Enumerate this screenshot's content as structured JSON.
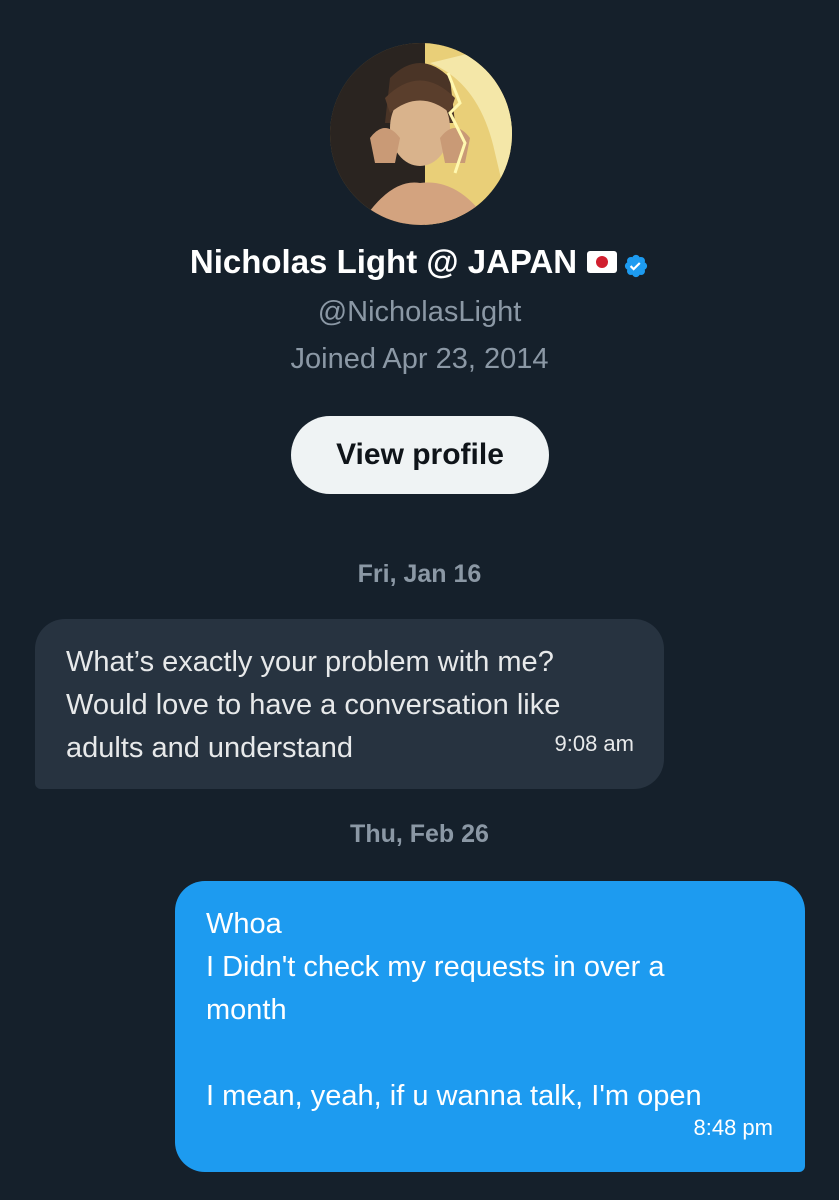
{
  "profile": {
    "name": "Nicholas Light @ JAPAN",
    "handle": "@NicholasLight",
    "joined": "Joined Apr 23, 2014",
    "view_profile_label": "View profile"
  },
  "conversation": [
    {
      "date": "Fri, Jan 16",
      "message": {
        "direction": "incoming",
        "lines": [
          "What’s exactly your problem with me?",
          "Would love to have a conversation like",
          "adults and understand"
        ],
        "time": "9:08 am"
      }
    },
    {
      "date": "Thu, Feb 26",
      "message": {
        "direction": "outgoing",
        "lines": [
          "Whoa",
          "I Didn't check my requests in over a",
          "month",
          "",
          "I mean, yeah, if u wanna talk, I'm open"
        ],
        "time": "8:48 pm"
      }
    }
  ],
  "icons": {
    "flag": "japan-flag-icon",
    "verified": "verified-badge-icon"
  },
  "colors": {
    "background": "#15202b",
    "incoming_bubble": "#273340",
    "outgoing_bubble": "#1d9bf0",
    "verified": "#1d9bf0",
    "muted_text": "#8b98a5"
  }
}
